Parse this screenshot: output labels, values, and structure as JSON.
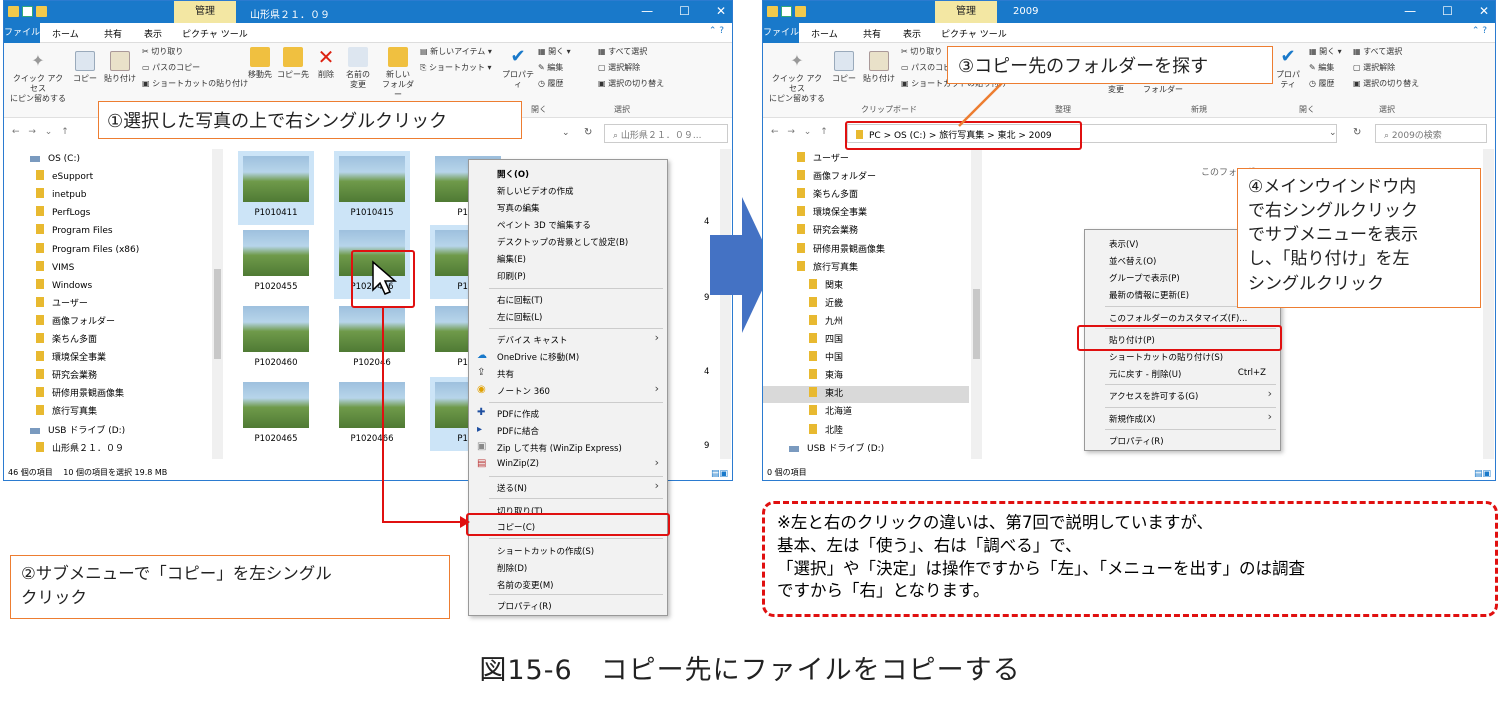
{
  "left_window": {
    "management_tab": "管理",
    "title": "山形県２１．０９",
    "menu": {
      "file": "ファイル",
      "home": "ホーム",
      "share": "共有",
      "view": "表示",
      "picture_tools": "ピクチャ ツール"
    },
    "ribbon": {
      "quick_access": "クイック アクセス\nにピン留めする",
      "copy": "コピー",
      "paste": "貼り付け",
      "cut": "切り取り",
      "copy_path": "パスのコピー",
      "paste_shortcut": "ショートカットの貼り付け",
      "move_to": "移動先",
      "copy_to": "コピー先",
      "delete": "削除",
      "rename": "名前の\n変更",
      "new_folder": "新しい\nフォルダー",
      "new_item": "新しいアイテム ▾",
      "shortcut": "ショートカット ▾",
      "properties": "プロパティ",
      "open": "開く ▾",
      "edit": "編集",
      "history": "履歴",
      "select_all": "すべて選択",
      "select_none": "選択解除",
      "invert": "選択の切り替え",
      "group_open": "開く",
      "group_select": "選択"
    },
    "search_placeholder": "山形県２１．０９...",
    "nav_items": [
      "OS (C:)",
      "eSupport",
      "inetpub",
      "PerfLogs",
      "Program Files",
      "Program Files (x86)",
      "VIMS",
      "Windows",
      "ユーザー",
      "画像フォルダー",
      "楽ちん多面",
      "環境保全事業",
      "研究会業務",
      "研修用景観画像集",
      "旅行写真集",
      "USB ドライブ (D:)",
      "山形県２１．０９"
    ],
    "photos": [
      {
        "name": "P1010411",
        "selected": true
      },
      {
        "name": "P1010415",
        "selected": true
      },
      {
        "name": "P101",
        "selected": false
      },
      {
        "name": "P1020455",
        "selected": false
      },
      {
        "name": "P1020456",
        "selected": true
      },
      {
        "name": "P102",
        "selected": true
      },
      {
        "name": "P1020460",
        "selected": false
      },
      {
        "name": "P102046",
        "selected": false
      },
      {
        "name": "P102",
        "selected": false
      },
      {
        "name": "P1020465",
        "selected": false
      },
      {
        "name": "P1020466",
        "selected": false
      },
      {
        "name": "P102",
        "selected": true
      }
    ],
    "right_edge_labels": [
      "4",
      "9",
      "4",
      "9"
    ],
    "status": "46 個の項目　 10 個の項目を選択  19.8 MB"
  },
  "context_menu_left": [
    {
      "label": "開く(O)",
      "bold": true
    },
    {
      "label": "新しいビデオの作成"
    },
    {
      "label": "写真の編集"
    },
    {
      "label": "ペイント 3D で編集する"
    },
    {
      "label": "デスクトップの背景として設定(B)"
    },
    {
      "label": "編集(E)"
    },
    {
      "label": "印刷(P)"
    },
    {
      "label": "右に回転(T)"
    },
    {
      "label": "左に回転(L)"
    },
    {
      "label": "デバイス キャスト",
      "submenu": true
    },
    {
      "label": "OneDrive に移動(M)"
    },
    {
      "label": "共有"
    },
    {
      "label": "ノートン 360",
      "submenu": true
    },
    {
      "label": "PDFに作成"
    },
    {
      "label": "PDFに結合"
    },
    {
      "label": "Zip して共有 (WinZip Express)"
    },
    {
      "label": "WinZip(Z)",
      "submenu": true
    },
    {
      "label": "送る(N)",
      "submenu": true
    },
    {
      "label": "切り取り(T)"
    },
    {
      "label": "コピー(C)"
    },
    {
      "label": "ショートカットの作成(S)"
    },
    {
      "label": "削除(D)"
    },
    {
      "label": "名前の変更(M)"
    },
    {
      "label": "プロパティ(R)"
    }
  ],
  "right_window": {
    "management_tab": "管理",
    "title": "2009",
    "breadcrumb": "PC  >  OS (C:)  >  旅行写真集  >  東北  >  2009",
    "search_placeholder": "2009の検索",
    "ribbon": {
      "cut": "切り取り",
      "copy_path": "パスのコピー",
      "paste_shortcut": "ショートカットの貼り付け",
      "group_clipboard": "クリップボード",
      "group_organize": "整理",
      "group_new": "新規",
      "group_open": "開く",
      "group_select": "選択",
      "change": "変更",
      "folder": "フォルダー"
    },
    "empty_text": "このフォルダー",
    "nav_items": [
      "ユーザー",
      "画像フォルダー",
      "楽ちん多面",
      "環境保全事業",
      "研究会業務",
      "研修用景観画像集",
      "旅行写真集",
      "関東",
      "近畿",
      "九州",
      "四国",
      "中国",
      "東海",
      "東北",
      "北海道",
      "北陸",
      "USB ドライブ (D:)"
    ],
    "status": "0 個の項目"
  },
  "context_menu_right": [
    {
      "label": "表示(V)"
    },
    {
      "label": "並べ替え(O)"
    },
    {
      "label": "グループで表示(P)"
    },
    {
      "label": "最新の情報に更新(E)"
    },
    {
      "label": "このフォルダーのカスタマイズ(F)..."
    },
    {
      "label": "貼り付け(P)"
    },
    {
      "label": "ショートカットの貼り付け(S)"
    },
    {
      "label": "元に戻す - 削除(U)",
      "shortcut": "Ctrl+Z"
    },
    {
      "label": "アクセスを許可する(G)",
      "submenu": true
    },
    {
      "label": "新規作成(X)",
      "submenu": true
    },
    {
      "label": "プロパティ(R)"
    }
  ],
  "callouts": {
    "c1": "①選択した写真の上で右シングルクリック",
    "c2": "②サブメニューで「コピー」を左シングル\nクリック",
    "c3": "③コピー先のフォルダーを探す",
    "c4": "④メインウインドウ内\nで右シングルクリック\nでサブメニューを表示\nし、「貼り付け」を左\nシングルクリック"
  },
  "note": "※左と右のクリックの違いは、第7回で説明していますが、\n基本、左は「使う」、右は「調べる」で、\n「選択」や「決定」は操作ですから「左」、「メニューを出す」のは調査\nですから「右」となります。",
  "caption": "図15-6　コピー先にファイルをコピーする",
  "colors": {
    "accent": "#1979ca",
    "callout_border": "#ed7d31",
    "highlight": "#e01010",
    "arrow": "#4472c4"
  }
}
